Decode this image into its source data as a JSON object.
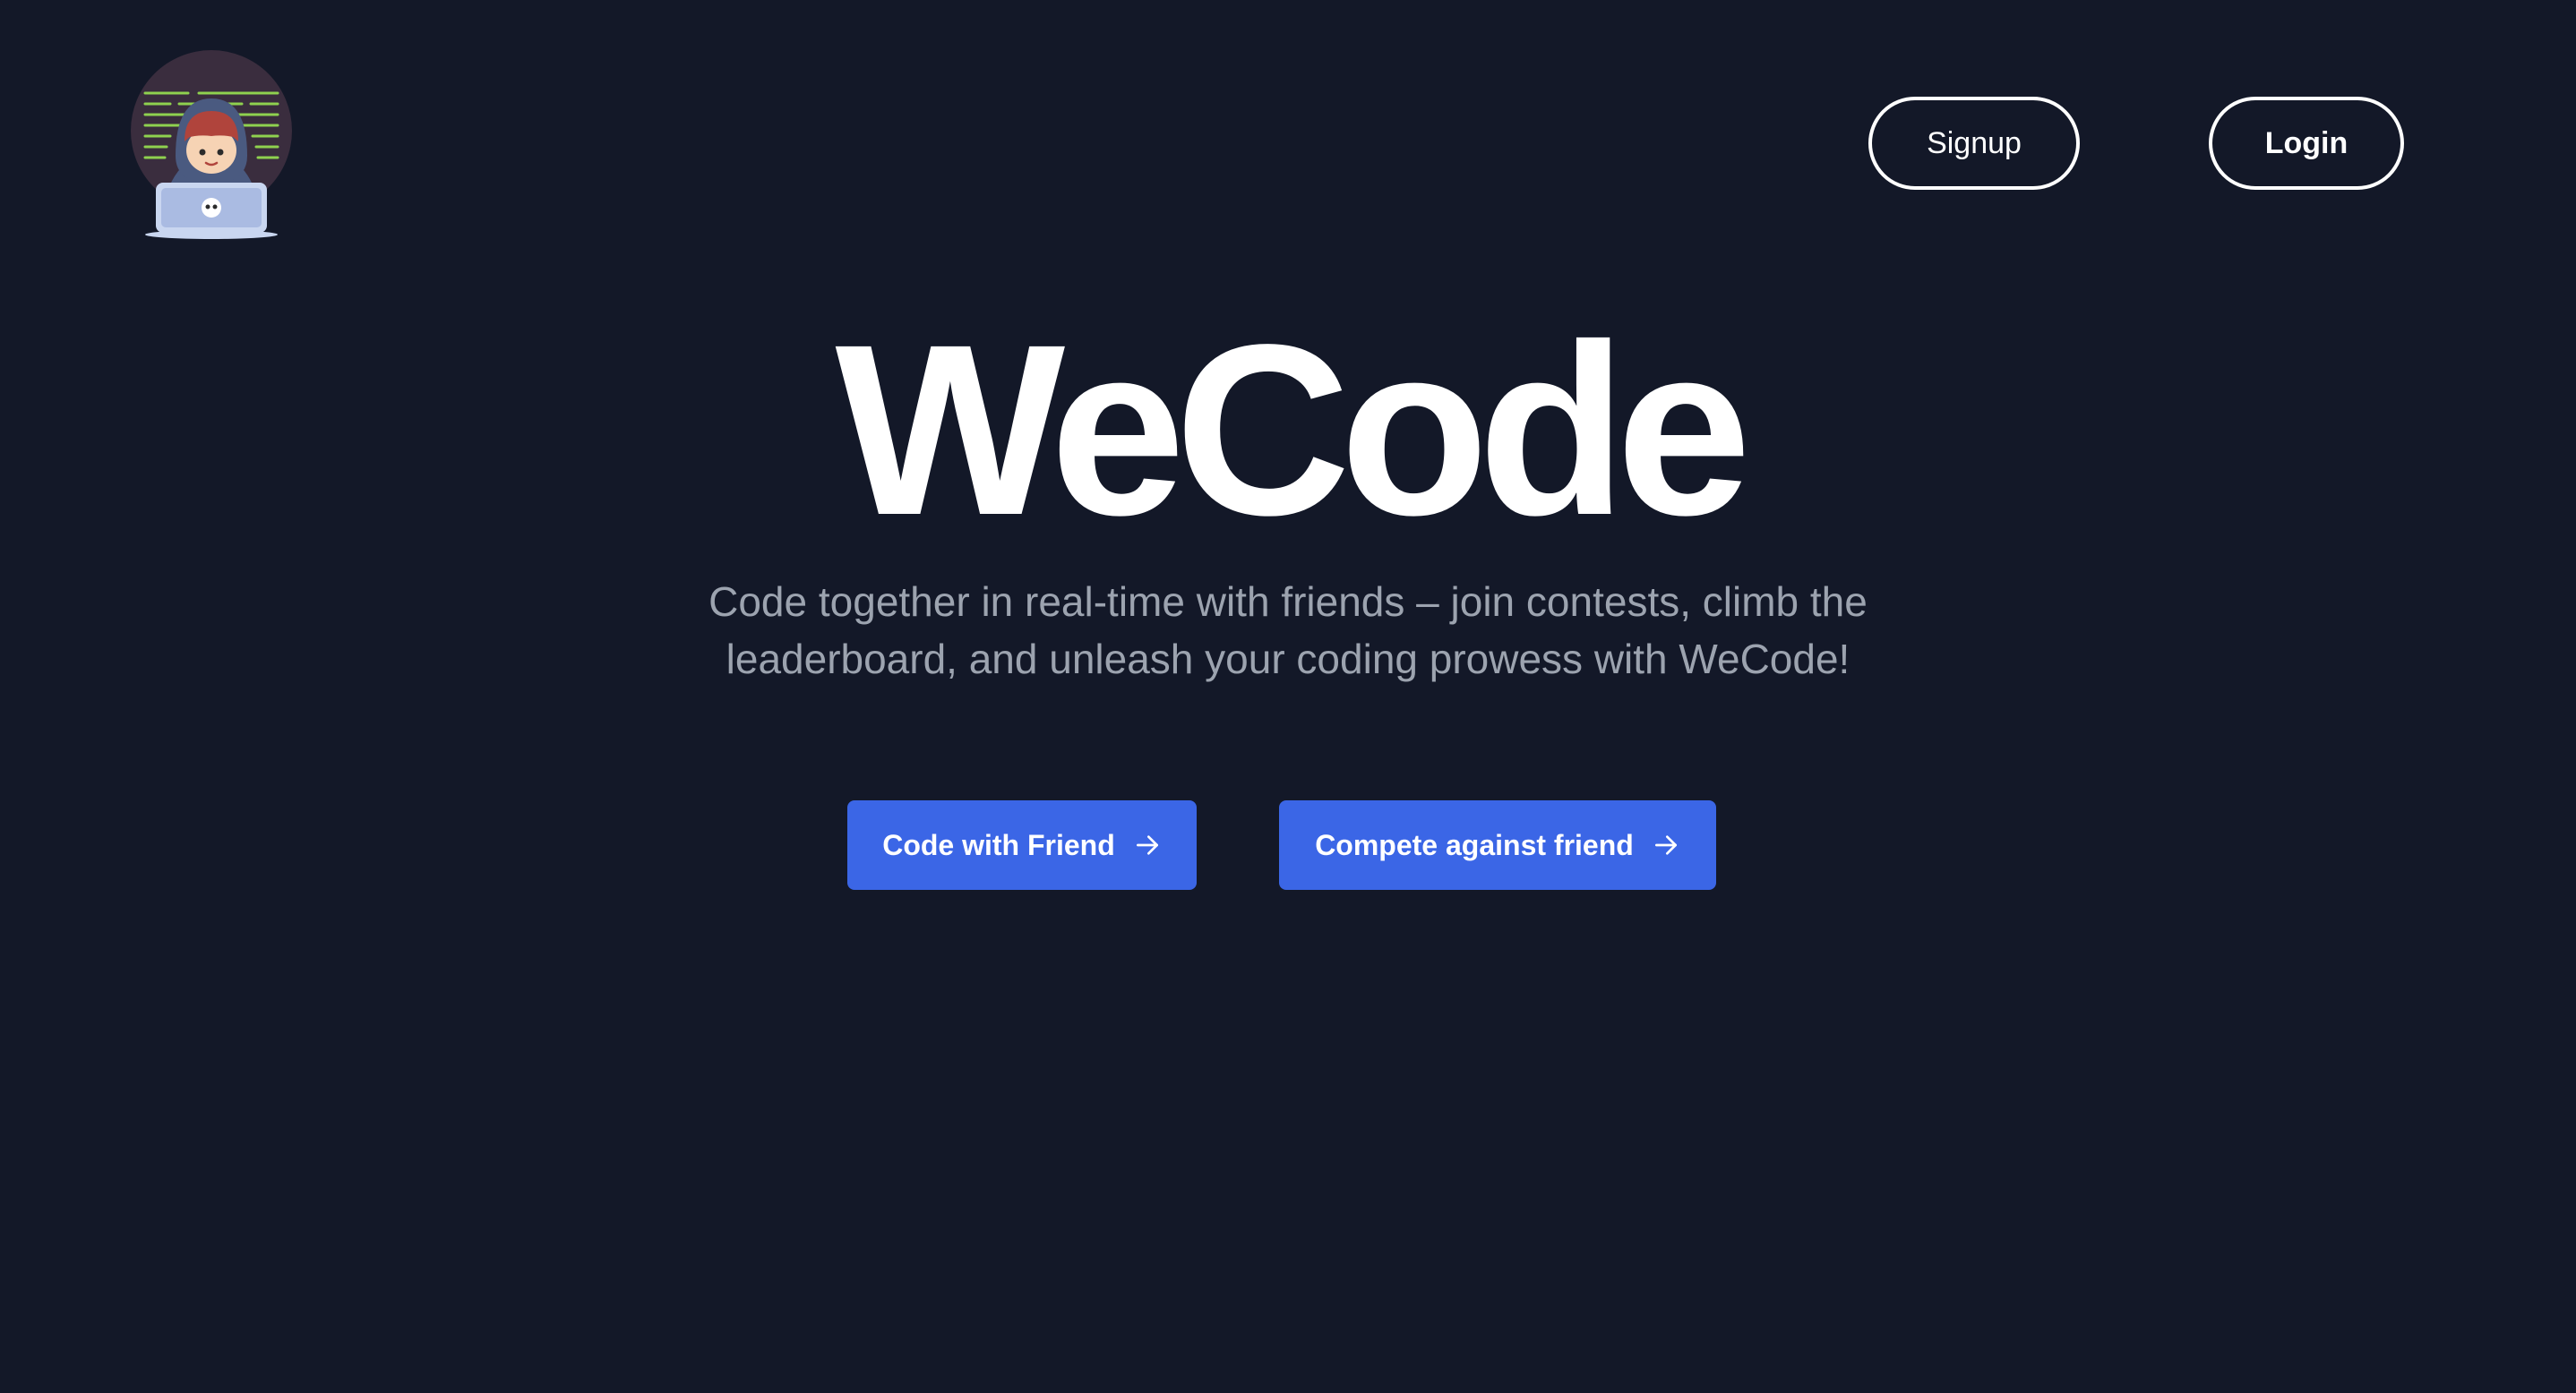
{
  "header": {
    "logo_icon": "hooded-coder-laptop-icon",
    "signup_label": "Signup",
    "login_label": "Login"
  },
  "hero": {
    "title": "WeCode",
    "subtitle": "Code together in real-time with friends – join contests, climb the leaderboard, and unleash your coding prowess with WeCode!"
  },
  "actions": {
    "code_with_friend_label": "Code with Friend",
    "compete_label": "Compete against friend",
    "arrow_icon": "arrow-right-icon"
  },
  "colors": {
    "background": "#131828",
    "primary": "#3b66e6",
    "subtitle_text": "#9ca3af",
    "text": "#ffffff"
  }
}
